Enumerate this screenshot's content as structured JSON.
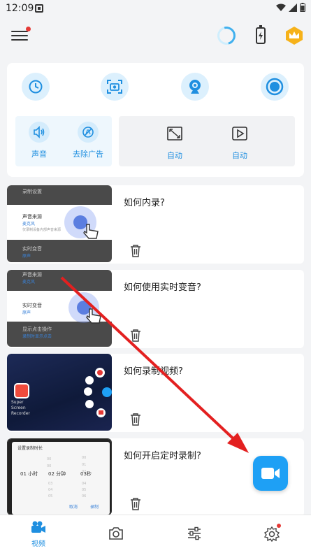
{
  "status_bar": {
    "time": "12:09"
  },
  "tools": {
    "sub_items": [
      {
        "label": "声音",
        "icon": "speaker-icon"
      },
      {
        "label": "去除广告",
        "icon": "no-ads-icon"
      }
    ],
    "auto_items": [
      {
        "label": "自动",
        "icon": "crop-icon"
      },
      {
        "label": "自动",
        "icon": "play-icon"
      }
    ]
  },
  "tutorials": [
    {
      "title": "如何内录?",
      "thumb": {
        "row1": "录制设置",
        "row2": "声音来源",
        "row2_sub": "麦克风",
        "row2_hint": "仅录制设备内部声音来源",
        "row3": "实时变音",
        "row3_sub": "原声"
      }
    },
    {
      "title": "如何使用实时变音?",
      "thumb": {
        "row1": "声音来源",
        "row1_sub": "麦克风",
        "row2": "实时变音",
        "row2_sub": "原声",
        "row3": "显示点击操作",
        "row3_sub": "录制时显示点击"
      }
    },
    {
      "title": "如何录制视频?",
      "thumb": {
        "app_name": "Super Screen Recorder"
      }
    },
    {
      "title": "如何开启定时录制?",
      "thumb": {
        "header": "设置录制时长",
        "hour": "01",
        "hour_unit": "小时",
        "minute": "02",
        "minute_unit": "分钟",
        "second": "03",
        "second_unit": "秒",
        "cancel": "取消",
        "confirm": "录制"
      }
    }
  ],
  "bottom_nav": [
    {
      "label": "视频",
      "icon": "video-camera-icon",
      "active": true
    },
    {
      "label": "",
      "icon": "camera-icon"
    },
    {
      "label": "",
      "icon": "sliders-icon"
    },
    {
      "label": "",
      "icon": "settings-icon"
    }
  ],
  "colors": {
    "accent": "#1ea0f5",
    "arrow": "#e32020",
    "badge": "#e53935"
  }
}
